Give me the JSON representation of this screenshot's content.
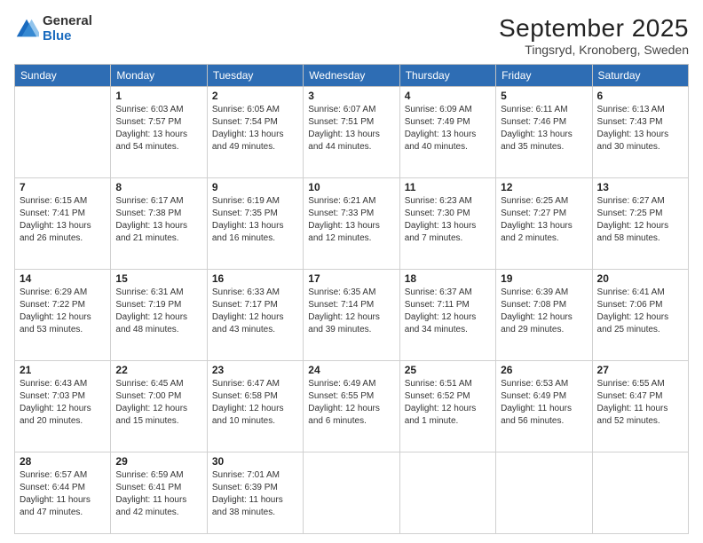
{
  "logo": {
    "general": "General",
    "blue": "Blue"
  },
  "title": "September 2025",
  "subtitle": "Tingsryd, Kronoberg, Sweden",
  "weekdays": [
    "Sunday",
    "Monday",
    "Tuesday",
    "Wednesday",
    "Thursday",
    "Friday",
    "Saturday"
  ],
  "weeks": [
    [
      {
        "day": "",
        "info": ""
      },
      {
        "day": "1",
        "info": "Sunrise: 6:03 AM\nSunset: 7:57 PM\nDaylight: 13 hours and 54 minutes."
      },
      {
        "day": "2",
        "info": "Sunrise: 6:05 AM\nSunset: 7:54 PM\nDaylight: 13 hours and 49 minutes."
      },
      {
        "day": "3",
        "info": "Sunrise: 6:07 AM\nSunset: 7:51 PM\nDaylight: 13 hours and 44 minutes."
      },
      {
        "day": "4",
        "info": "Sunrise: 6:09 AM\nSunset: 7:49 PM\nDaylight: 13 hours and 40 minutes."
      },
      {
        "day": "5",
        "info": "Sunrise: 6:11 AM\nSunset: 7:46 PM\nDaylight: 13 hours and 35 minutes."
      },
      {
        "day": "6",
        "info": "Sunrise: 6:13 AM\nSunset: 7:43 PM\nDaylight: 13 hours and 30 minutes."
      }
    ],
    [
      {
        "day": "7",
        "info": "Sunrise: 6:15 AM\nSunset: 7:41 PM\nDaylight: 13 hours and 26 minutes."
      },
      {
        "day": "8",
        "info": "Sunrise: 6:17 AM\nSunset: 7:38 PM\nDaylight: 13 hours and 21 minutes."
      },
      {
        "day": "9",
        "info": "Sunrise: 6:19 AM\nSunset: 7:35 PM\nDaylight: 13 hours and 16 minutes."
      },
      {
        "day": "10",
        "info": "Sunrise: 6:21 AM\nSunset: 7:33 PM\nDaylight: 13 hours and 12 minutes."
      },
      {
        "day": "11",
        "info": "Sunrise: 6:23 AM\nSunset: 7:30 PM\nDaylight: 13 hours and 7 minutes."
      },
      {
        "day": "12",
        "info": "Sunrise: 6:25 AM\nSunset: 7:27 PM\nDaylight: 13 hours and 2 minutes."
      },
      {
        "day": "13",
        "info": "Sunrise: 6:27 AM\nSunset: 7:25 PM\nDaylight: 12 hours and 58 minutes."
      }
    ],
    [
      {
        "day": "14",
        "info": "Sunrise: 6:29 AM\nSunset: 7:22 PM\nDaylight: 12 hours and 53 minutes."
      },
      {
        "day": "15",
        "info": "Sunrise: 6:31 AM\nSunset: 7:19 PM\nDaylight: 12 hours and 48 minutes."
      },
      {
        "day": "16",
        "info": "Sunrise: 6:33 AM\nSunset: 7:17 PM\nDaylight: 12 hours and 43 minutes."
      },
      {
        "day": "17",
        "info": "Sunrise: 6:35 AM\nSunset: 7:14 PM\nDaylight: 12 hours and 39 minutes."
      },
      {
        "day": "18",
        "info": "Sunrise: 6:37 AM\nSunset: 7:11 PM\nDaylight: 12 hours and 34 minutes."
      },
      {
        "day": "19",
        "info": "Sunrise: 6:39 AM\nSunset: 7:08 PM\nDaylight: 12 hours and 29 minutes."
      },
      {
        "day": "20",
        "info": "Sunrise: 6:41 AM\nSunset: 7:06 PM\nDaylight: 12 hours and 25 minutes."
      }
    ],
    [
      {
        "day": "21",
        "info": "Sunrise: 6:43 AM\nSunset: 7:03 PM\nDaylight: 12 hours and 20 minutes."
      },
      {
        "day": "22",
        "info": "Sunrise: 6:45 AM\nSunset: 7:00 PM\nDaylight: 12 hours and 15 minutes."
      },
      {
        "day": "23",
        "info": "Sunrise: 6:47 AM\nSunset: 6:58 PM\nDaylight: 12 hours and 10 minutes."
      },
      {
        "day": "24",
        "info": "Sunrise: 6:49 AM\nSunset: 6:55 PM\nDaylight: 12 hours and 6 minutes."
      },
      {
        "day": "25",
        "info": "Sunrise: 6:51 AM\nSunset: 6:52 PM\nDaylight: 12 hours and 1 minute."
      },
      {
        "day": "26",
        "info": "Sunrise: 6:53 AM\nSunset: 6:49 PM\nDaylight: 11 hours and 56 minutes."
      },
      {
        "day": "27",
        "info": "Sunrise: 6:55 AM\nSunset: 6:47 PM\nDaylight: 11 hours and 52 minutes."
      }
    ],
    [
      {
        "day": "28",
        "info": "Sunrise: 6:57 AM\nSunset: 6:44 PM\nDaylight: 11 hours and 47 minutes."
      },
      {
        "day": "29",
        "info": "Sunrise: 6:59 AM\nSunset: 6:41 PM\nDaylight: 11 hours and 42 minutes."
      },
      {
        "day": "30",
        "info": "Sunrise: 7:01 AM\nSunset: 6:39 PM\nDaylight: 11 hours and 38 minutes."
      },
      {
        "day": "",
        "info": ""
      },
      {
        "day": "",
        "info": ""
      },
      {
        "day": "",
        "info": ""
      },
      {
        "day": "",
        "info": ""
      }
    ]
  ]
}
